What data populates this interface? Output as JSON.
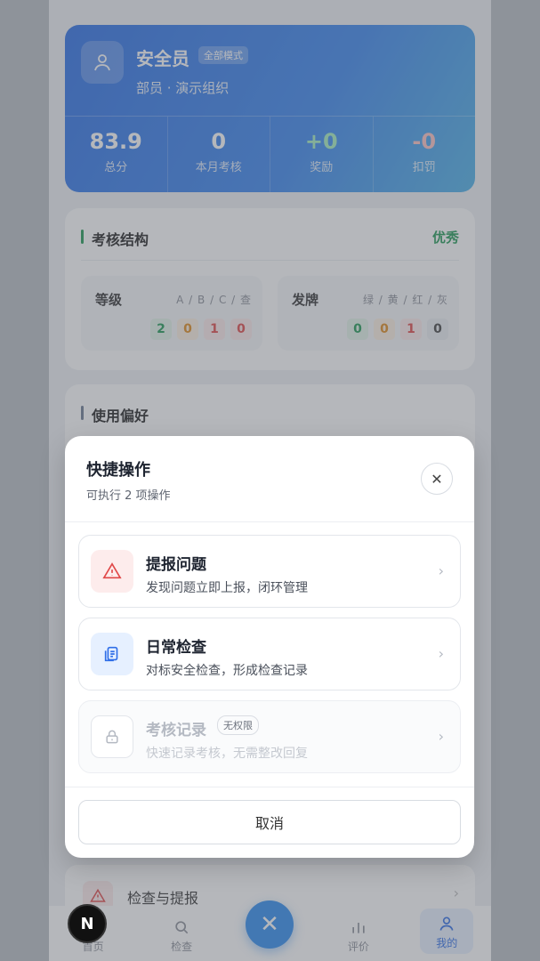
{
  "profile": {
    "name": "安全员",
    "mode": "全部模式",
    "org": "部员 · 演示组织",
    "stats": [
      {
        "value": "83.9",
        "label": "总分"
      },
      {
        "value": "0",
        "label": "本月考核"
      },
      {
        "value": "+0",
        "label": "奖励"
      },
      {
        "value": "-0",
        "label": "扣罚"
      }
    ]
  },
  "structure": {
    "title": "考核结构",
    "badge": "优秀",
    "grade": {
      "title": "等级",
      "keys": "A / B / C / 查",
      "values": [
        "2",
        "0",
        "1",
        "0"
      ]
    },
    "card": {
      "title": "发牌",
      "keys": "绿 / 黄 / 红 / 灰",
      "values": [
        "0",
        "0",
        "1",
        "0"
      ]
    }
  },
  "preferences": {
    "title": "使用偏好"
  },
  "list_item": {
    "label": "检查与提报"
  },
  "tabs": [
    {
      "label": "首页"
    },
    {
      "label": "检查"
    },
    {
      "label": "评价"
    },
    {
      "label": "我的"
    }
  ],
  "modal": {
    "title": "快捷操作",
    "subtitle": "可执行 2 项操作",
    "actions": [
      {
        "title": "提报问题",
        "desc": "发现问题立即上报，闭环管理"
      },
      {
        "title": "日常检查",
        "desc": "对标安全检查，形成检查记录"
      },
      {
        "title": "考核记录",
        "desc": "快速记录考核，无需整改回复",
        "tag": "无权限"
      }
    ],
    "cancel": "取消"
  },
  "badge_letter": "N",
  "colors": {
    "primary": "#2f6ee8",
    "success": "#1f9a54",
    "danger": "#e04848",
    "warning": "#e08a1c"
  }
}
